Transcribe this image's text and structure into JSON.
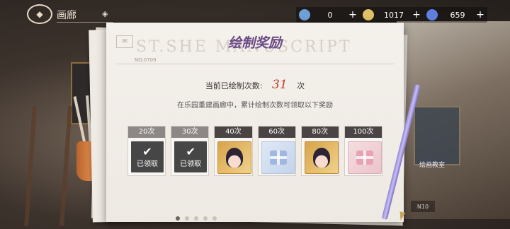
{
  "header": {
    "title": "画廊",
    "resources": [
      {
        "icon": "pen-resource-icon",
        "value": "0"
      },
      {
        "icon": "gold-coin-icon",
        "value": "1017"
      },
      {
        "icon": "diamond-gem-icon",
        "value": "659"
      }
    ],
    "plus": "+"
  },
  "dialog": {
    "title": "绘制奖励",
    "watermark": "ST.SHE       MANUSCRIPT",
    "doc_no": "NO.0709",
    "count_label": "当前已绘制次数:",
    "count_value": "31",
    "count_unit": "次",
    "description": "在乐园重建画廊中，累计绘制次数可领取以下奖励",
    "rewards": [
      {
        "label": "20次",
        "status": "已领取",
        "claimed": true
      },
      {
        "label": "30次",
        "status": "已领取",
        "claimed": true
      },
      {
        "label": "40次",
        "item": "portrait-avatar",
        "claimed": false
      },
      {
        "label": "60次",
        "item": "blue-gift-box",
        "claimed": false
      },
      {
        "label": "80次",
        "item": "portrait-avatar",
        "claimed": false
      },
      {
        "label": "100次",
        "item": "pink-gift-box",
        "claimed": false
      }
    ]
  },
  "pagination": {
    "count": 5,
    "active": 0
  },
  "side": {
    "label": "绘画教室",
    "pill": "N10"
  },
  "colors": {
    "accent": "#6b4a86",
    "count": "#c0392b",
    "claimed_label": "#8d8886"
  }
}
